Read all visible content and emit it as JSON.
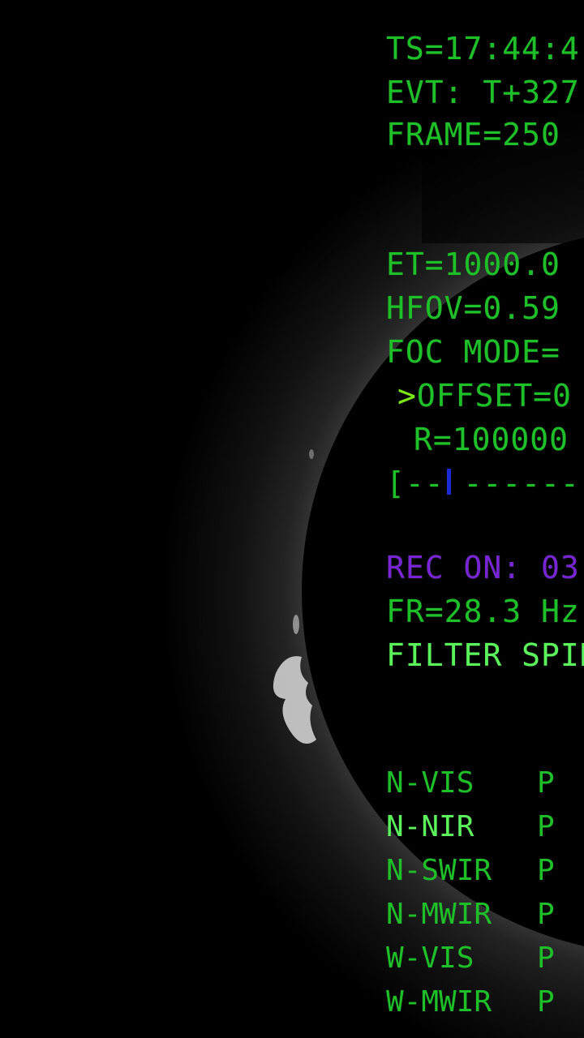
{
  "hud": {
    "ts": "TS=17:44:4",
    "evt": "EVT: T+327",
    "frame": "FRAME=250",
    "et": "ET=1000.0",
    "hfov": "HFOV=0.59",
    "foc_mode": "FOC MODE=",
    "offset_marker": ">",
    "offset": "OFFSET=0",
    "range": "R=100000",
    "focus_scale": "[-- ------",
    "rec": "REC ON: 03",
    "fr": "FR=28.3 Hz",
    "filter": "FILTER SPIN"
  },
  "bands": [
    {
      "name": "N-VIS",
      "mode": "P"
    },
    {
      "name": "N-NIR",
      "mode": "P"
    },
    {
      "name": "N-SWIR",
      "mode": "P"
    },
    {
      "name": "N-MWIR",
      "mode": "P"
    },
    {
      "name": "W-VIS",
      "mode": "P"
    },
    {
      "name": "W-MWIR",
      "mode": "P"
    }
  ],
  "selected_band": "N-NIR",
  "colors": {
    "hud": "#1fbf2a",
    "hud_bright": "#5cf25c",
    "rec": "#7a22d6",
    "focus_tick": "#1a2bd6"
  },
  "focus_offset_fraction": 0.3
}
